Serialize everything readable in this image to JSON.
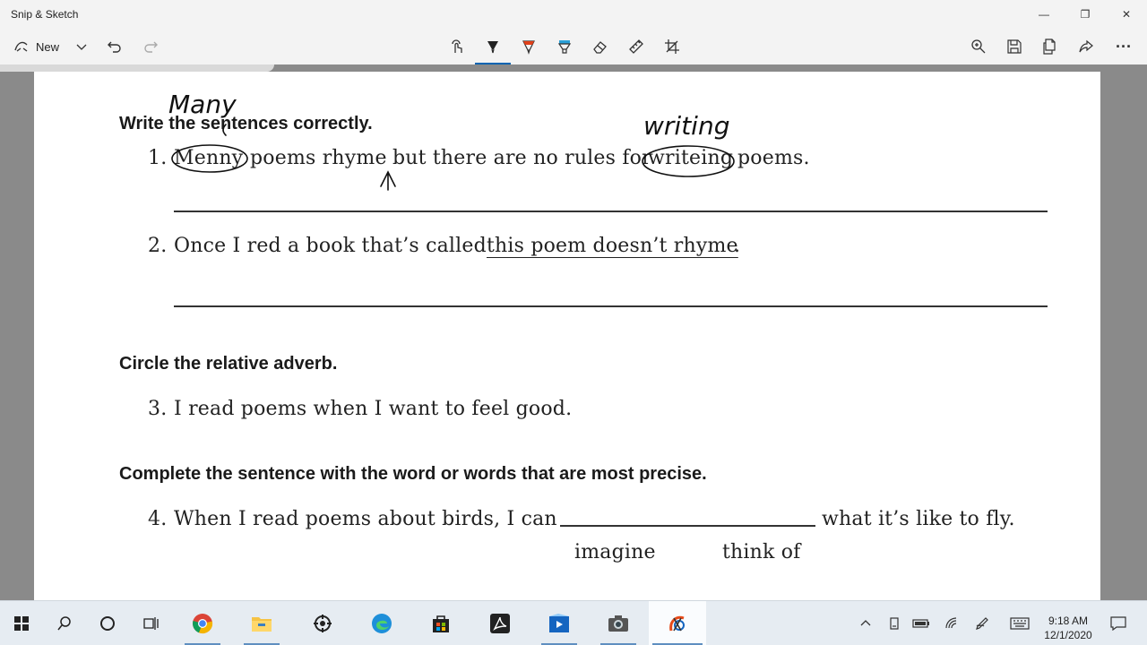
{
  "window": {
    "title": "Snip & Sketch",
    "minimize_glyph": "—",
    "maximize_glyph": "❐",
    "close_glyph": "✕"
  },
  "toolbar": {
    "new_label": "New",
    "tools": [
      "touch-writing-icon",
      "ballpoint-pen-icon",
      "pencil-icon",
      "highlighter-icon",
      "eraser-icon",
      "ruler-icon",
      "crop-icon"
    ],
    "right_tools": [
      "zoom-icon",
      "save-icon",
      "copy-icon",
      "share-icon",
      "more-icon"
    ],
    "more_glyph": "···",
    "active_color": "#0063b1"
  },
  "worksheet": {
    "section1_heading": "Write the sentences correctly.",
    "item1": {
      "number": "1.",
      "w1": "Menny",
      "w2": "poems rhyme",
      "w3": "but there are no rules for",
      "w4": "writeing",
      "w5": "poems."
    },
    "item2": {
      "number": "2.",
      "pre": "Once I red a book that’s called",
      "title": "this poem doesn’t rhyme",
      "post": "."
    },
    "section2_heading": "Circle the relative adverb.",
    "item3": {
      "number": "3.",
      "text": "I read poems when I want to feel good."
    },
    "section3_heading": "Complete the sentence with the word or words that are most precise.",
    "item4": {
      "number": "4.",
      "pre": "When I read poems about birds, I can",
      "post": "what it’s like to fly.",
      "choice1": "imagine",
      "choice2": "think of"
    }
  },
  "handwriting": {
    "correction1": "Many",
    "correction2": "writing",
    "ink_color": "#111111"
  },
  "taskbar": {
    "apps": [
      "windows-start-icon",
      "search-icon",
      "cortana-icon",
      "task-view-icon",
      "chrome-icon",
      "file-explorer-icon",
      "app-icon",
      "edge-icon",
      "store-icon",
      "acrobat-icon",
      "media-app-icon",
      "camera-icon",
      "snip-sketch-icon"
    ],
    "time": "9:18 AM",
    "date": "12/1/2020"
  }
}
